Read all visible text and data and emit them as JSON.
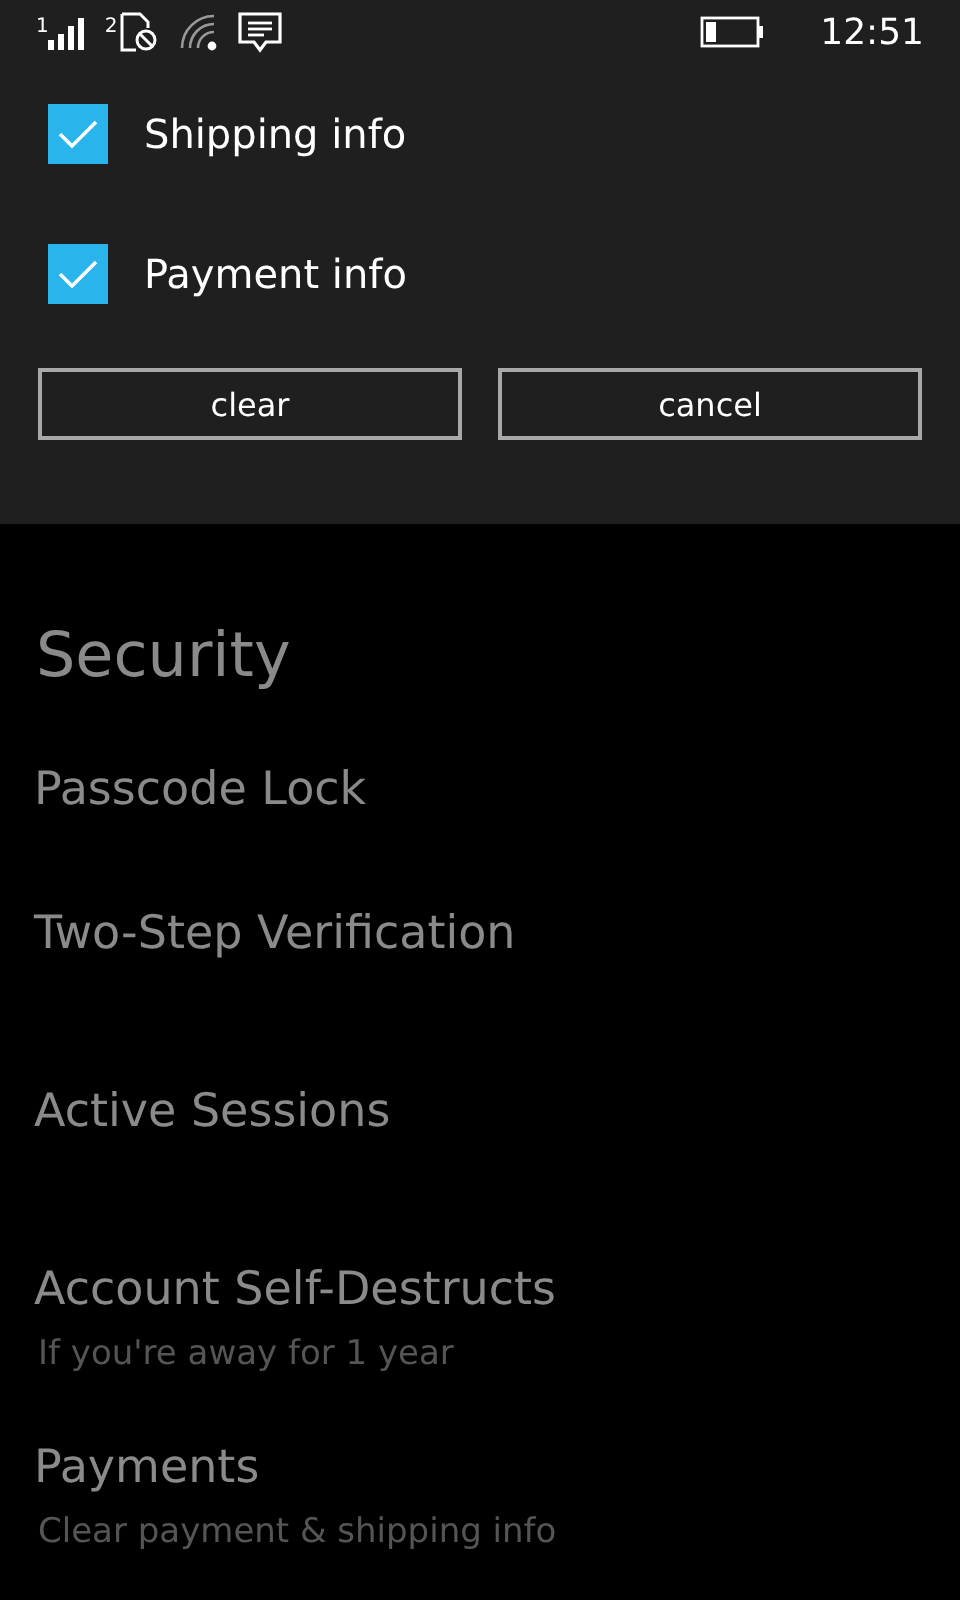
{
  "status_bar": {
    "sim1_label": "1",
    "sim2_label": "2",
    "time": "12:51"
  },
  "dialog": {
    "options": [
      {
        "label": "Shipping info",
        "checked": true
      },
      {
        "label": "Payment info",
        "checked": true
      }
    ],
    "buttons": [
      "clear",
      "cancel"
    ]
  },
  "page": {
    "section_title": "Security",
    "items": [
      {
        "title": "Passcode Lock"
      },
      {
        "title": "Two-Step Verification"
      },
      {
        "title": "Active Sessions"
      },
      {
        "title": "Account Self-Destructs",
        "subtitle": "If you're away for 1 year"
      },
      {
        "title": "Payments",
        "subtitle": "Clear payment & shipping info"
      }
    ]
  }
}
